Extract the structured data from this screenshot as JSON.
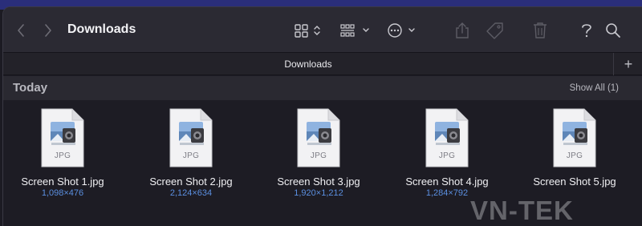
{
  "window": {
    "title": "Downloads",
    "tab_label": "Downloads",
    "new_tab": "+"
  },
  "toolbar": {
    "icons": [
      "back-arrow-icon",
      "forward-arrow-icon",
      "icon-view-icon",
      "group-icon",
      "more-actions-icon",
      "share-icon",
      "tag-icon",
      "trash-icon",
      "help-icon",
      "search-icon"
    ]
  },
  "section": {
    "title": "Today",
    "show_all": "Show All (1)"
  },
  "files": [
    {
      "name": "Screen Shot 1.jpg",
      "dims": "1,098×476",
      "type": "JPG"
    },
    {
      "name": "Screen Shot 2.jpg",
      "dims": "2,124×634",
      "type": "JPG"
    },
    {
      "name": "Screen Shot 3.jpg",
      "dims": "1,920×1,212",
      "type": "JPG"
    },
    {
      "name": "Screen Shot 4.jpg",
      "dims": "1,284×792",
      "type": "JPG"
    },
    {
      "name": "Screen Shot 5.jpg",
      "dims": "",
      "type": "JPG"
    }
  ],
  "watermark": "VN-TEK",
  "colors": {
    "background": "#1d1c24",
    "toolbar": "#2b2a33",
    "dims_link": "#5b8fe0"
  }
}
